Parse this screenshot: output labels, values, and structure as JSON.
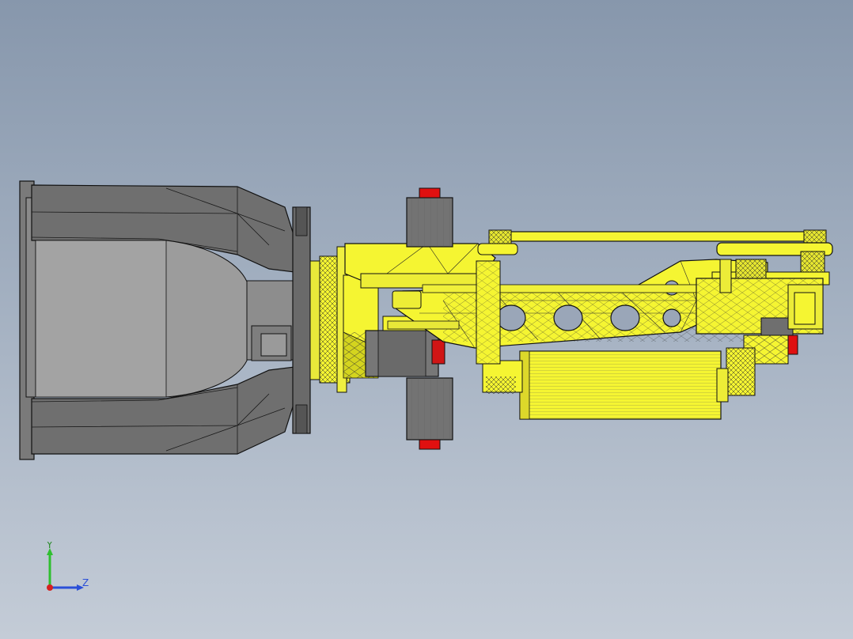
{
  "viewport": {
    "background_top": "#8797ac",
    "background_bottom": "#c4ccd7"
  },
  "colors": {
    "yellow_part": "#f5f532",
    "yellow_dark": "#c9c91a",
    "gray_part": "#6f6f6f",
    "gray_light": "#9a9a9a",
    "red_cap": "#e01010",
    "edge": "#111111"
  },
  "triad": {
    "y_label": "Y",
    "z_label": "Z",
    "y_color": "#2fbf2f",
    "z_color": "#2a4fd8",
    "x_color": "#d62020"
  }
}
